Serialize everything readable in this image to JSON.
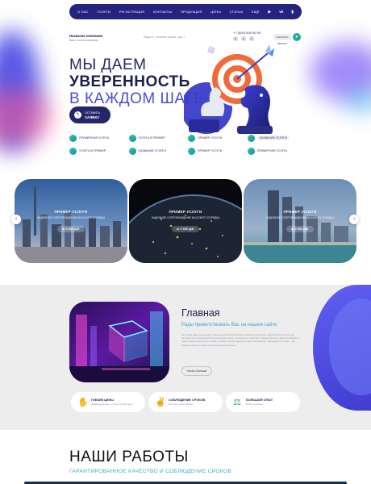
{
  "nav": {
    "items": [
      "О НАС",
      "УСЛУГИ",
      "РЕГИСТРАЦИЯ",
      "КОНТАКТЫ",
      "ПРОДУКЦИЯ",
      "ЦЕНЫ",
      "СТАТЬИ",
      "ЕЩЁ"
    ],
    "social": [
      "youtube-icon",
      "vk-icon",
      "mobile-icon"
    ]
  },
  "header": {
    "company_name": "Название компании",
    "company_slogan": "Ваш слоган компании",
    "search_placeholder": "Ищите, главное умом, док ?",
    "phone": "+7 (000) 000 00 00",
    "call_label": "ЗАКАЗАТЬ ЗВОНОК"
  },
  "hero": {
    "line1": "МЫ ДАЕМ",
    "line2": "УВЕРЕННОСТЬ",
    "line3": "В КАЖДОМ ШАГЕ",
    "button_top": "ОСТАВИТЬ",
    "button_bottom": "ЗАЯВКУ"
  },
  "chips": [
    "ПРИМЕРНАЯ УСЛУГА",
    "УСЛУГА В ПРИМЕР",
    "ПРИМЕР УСЛУГИ",
    "НАЗВАНИЕ УСЛУГИ",
    "УСЛУГА В ПРИМЕР",
    "НАЗВАНИЕ УСЛУГИ",
    "ПРИМЕР УСЛУГИ",
    "ПРИМЕРНАЯ УСЛУГА"
  ],
  "cards": [
    {
      "title": "ПРИМЕР УСЛУГИ",
      "subtitle": "НАДЕЖНОЕ СОПРОВОЖДЕНИЕ ВЫСОКОГО ПОРЯДКА",
      "price": "от 2 500 руб."
    },
    {
      "title": "ПРИМЕР УСЛУГИ",
      "subtitle": "НАДЕЖНОЕ СОПРОВОЖДЕНИЕ ВЫСОКОГО ПОРЯДКА",
      "price": "от 2 500 руб."
    },
    {
      "title": "ПРИМЕР УСЛУГИ",
      "subtitle": "НАДЕЖНОЕ СОПРОВОЖДЕНИЕ ВЫСОКОГО ПОРЯДКА",
      "price": "от 2 500 руб."
    }
  ],
  "about": {
    "title": "Главная",
    "subtitle": "Рады приветствовать Вас на нашем сайте",
    "text": "Мы будем рады видеть вас в числе наших клиентов. Наша компания предлагает широкий спектр услуг для частных лиц и организаций. Мы работаем честно, прозрачно и с заботой о каждом клиенте. Наши специалисты имеют многолетний опыт и помогут решить любую задачу быстро и качественно. Обращайтесь к нам — мы всегда на связи и готовы ответить на ваши вопросы.",
    "more_label": "Узнать больше"
  },
  "features": [
    {
      "title": "ГИБКИЕ ЦЕНЫ",
      "subtitle": "Индивидуально и по доступной цене",
      "icon": "hand-coins-icon"
    },
    {
      "title": "СОБЛЮДЕНИЕ СРОКОВ",
      "subtitle": "Быстро и качественно",
      "icon": "handshake-icon"
    },
    {
      "title": "БОЛЬШОЙ ОПЫТ",
      "subtitle": "Опыт на рынке",
      "icon": "scales-icon"
    }
  ],
  "works": {
    "title": "НАШИ РАБОТЫ",
    "subtitle": "ГАРАНТИРОВАННОЕ КАЧЕСТВО И СОБЛЮДЕНИЕ СРОКОВ"
  },
  "colors": {
    "nav_bg": "#25237e",
    "accent_blue": "#4a4cd8",
    "teal": "#22a9a0",
    "heading": "#1b1d4a"
  }
}
